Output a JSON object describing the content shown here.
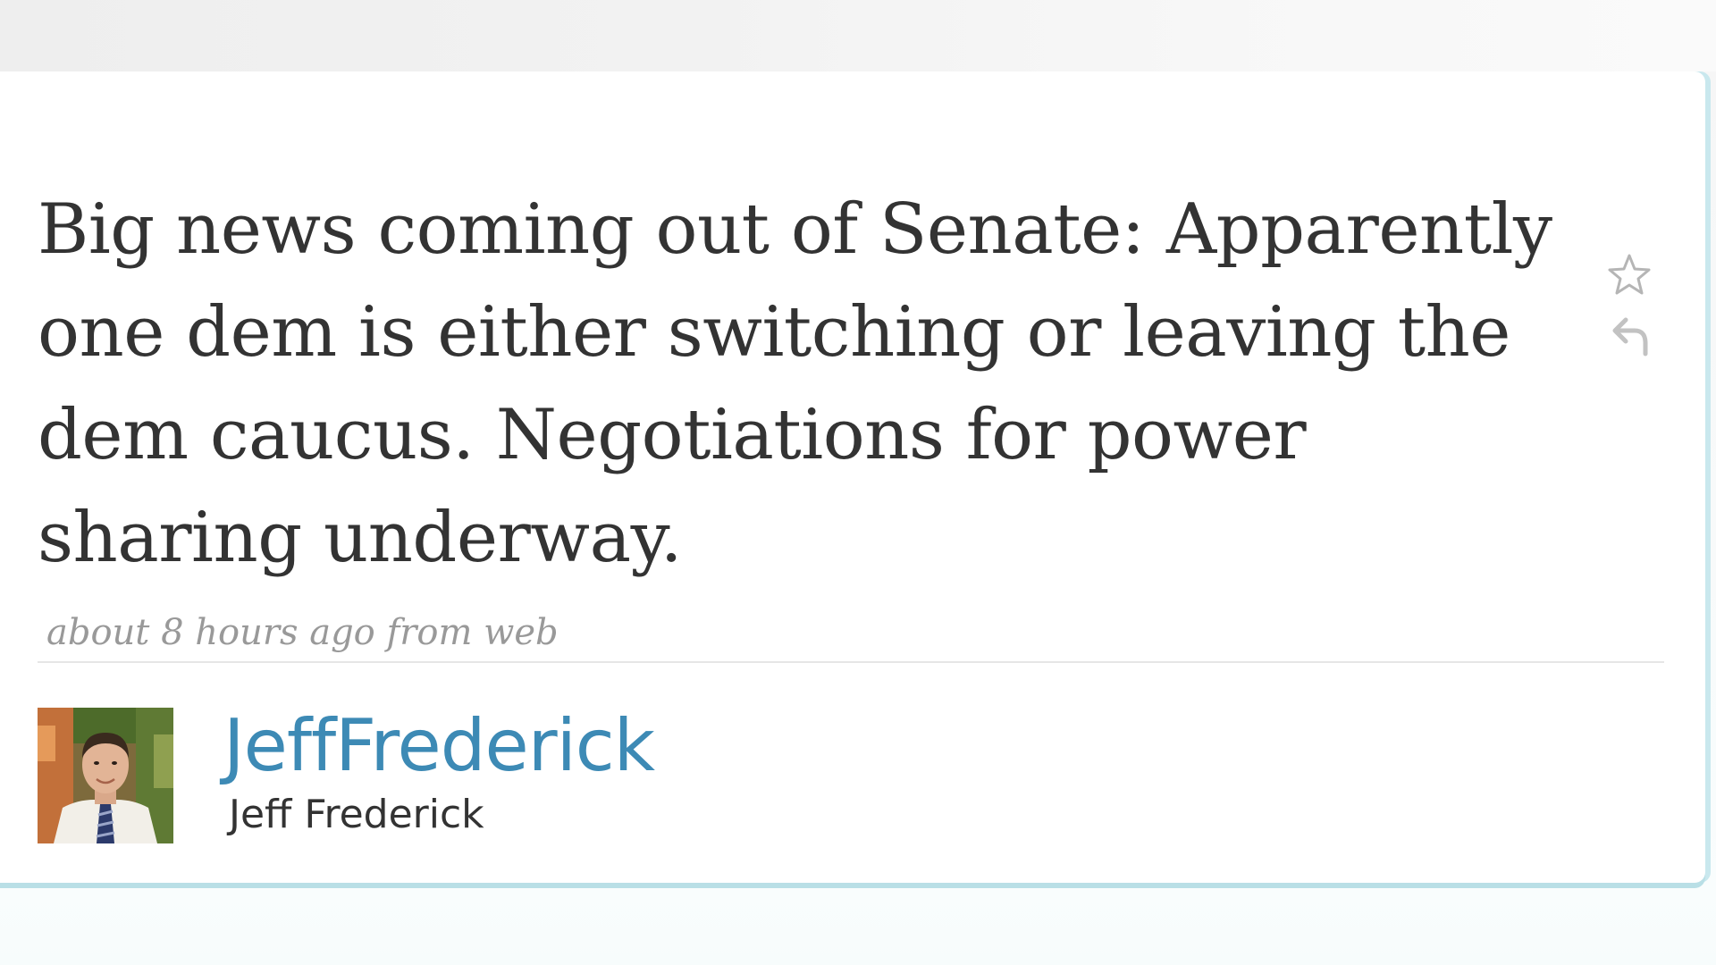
{
  "tweet": {
    "text": "Big news coming out of Senate: Apparently one dem is either switching or leaving the dem caucus. Negotiations for power sharing underway.",
    "timestamp": "about 8 hours ago",
    "source_prefix": " from ",
    "source": "web"
  },
  "author": {
    "screen_name": "JeffFrederick",
    "full_name": "Jeff Frederick"
  },
  "actions": {
    "favorite_icon": "star-outline-icon",
    "reply_icon": "reply-arrow-icon"
  },
  "colors": {
    "link": "#3d8ab5",
    "text": "#333333",
    "meta": "#999999",
    "card_border": "#b9dfe6"
  }
}
